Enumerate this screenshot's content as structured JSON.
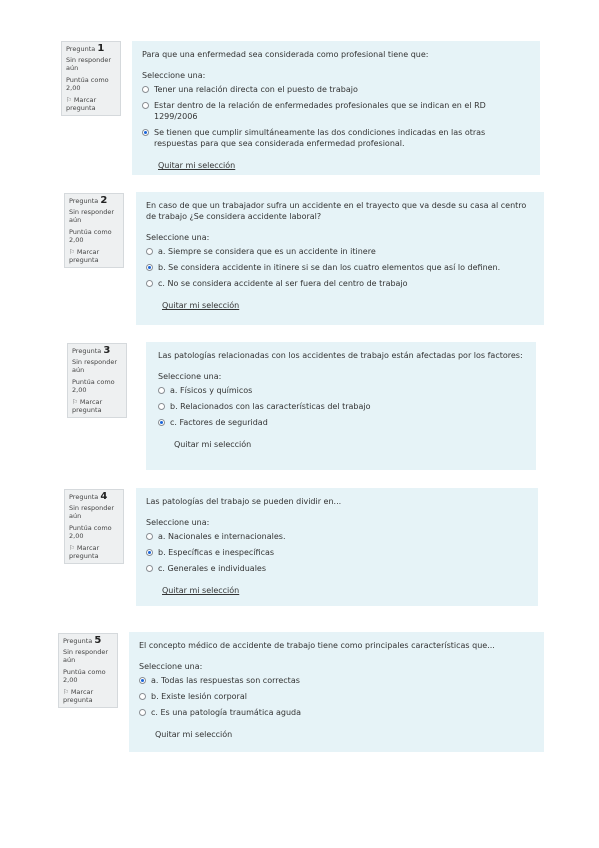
{
  "questions": [
    {
      "label": "Pregunta",
      "number": "1",
      "status": "Sin responder aún",
      "score": "Puntúa como 2,00",
      "flag_label": "Marcar pregunta",
      "text": "Para que una enfermedad sea considerada como profesional tiene que:",
      "select_label": "Seleccione una:",
      "options": [
        {
          "label": "Tener una relación directa con el puesto de trabajo",
          "selected": false
        },
        {
          "label": "Estar dentro de la relación de enfermedades profesionales que se indican en el RD 1299/2006",
          "selected": false
        },
        {
          "label": "Se tienen que cumplir simultáneamente las dos condiciones indicadas en las otras respuestas para que sea considerada enfermedad profesional.",
          "selected": true
        }
      ],
      "clear_label": "Quitar mi selección"
    },
    {
      "label": "Pregunta",
      "number": "2",
      "status": "Sin responder aún",
      "score": "Puntúa como 2,00",
      "flag_label": "Marcar pregunta",
      "text": "En caso de que un trabajador sufra un accidente en el trayecto que va desde su casa al centro de trabajo ¿Se considera accidente laboral?",
      "select_label": "Seleccione una:",
      "options": [
        {
          "label": "a. Siempre se considera que es un accidente in itinere",
          "selected": false
        },
        {
          "label": "b. Se considera accidente in itinere si se dan los cuatro elementos que así lo definen.",
          "selected": true
        },
        {
          "label": "c. No se considera accidente al ser fuera del centro de trabajo",
          "selected": false
        }
      ],
      "clear_label": "Quitar mi selección"
    },
    {
      "label": "Pregunta",
      "number": "3",
      "status": "Sin responder aún",
      "score": "Puntúa como 2,00",
      "flag_label": "Marcar pregunta",
      "text": "Las patologías relacionadas con los accidentes de trabajo están afectadas por los factores:",
      "select_label": "Seleccione una:",
      "options": [
        {
          "label": "a. Físicos y químicos",
          "selected": false
        },
        {
          "label": "b. Relacionados con las características del trabajo",
          "selected": false
        },
        {
          "label": "c. Factores de seguridad",
          "selected": true
        }
      ],
      "clear_label": "Quitar mi selección"
    },
    {
      "label": "Pregunta",
      "number": "4",
      "status": "Sin responder aún",
      "score": "Puntúa como 2,00",
      "flag_label": "Marcar pregunta",
      "text": "Las patologías del trabajo se pueden dividir en...",
      "select_label": "Seleccione una:",
      "options": [
        {
          "label": "a. Nacionales e internacionales.",
          "selected": false
        },
        {
          "label": "b. Específicas e inespecíficas",
          "selected": true
        },
        {
          "label": "c. Generales e individuales",
          "selected": false
        }
      ],
      "clear_label": "Quitar mi selección"
    },
    {
      "label": "Pregunta",
      "number": "5",
      "status": "Sin responder aún",
      "score": "Puntúa como 2,00",
      "flag_label": "Marcar pregunta",
      "text": "El concepto médico de accidente de trabajo tiene como principales características que...",
      "select_label": "Seleccione una:",
      "options": [
        {
          "label": "a. Todas las respuestas son correctas",
          "selected": true
        },
        {
          "label": "b. Existe lesión corporal",
          "selected": false
        },
        {
          "label": "c. Es una patología traumática aguda",
          "selected": false
        }
      ],
      "clear_label": "Quitar mi selección"
    }
  ],
  "colors": {
    "panel_bg": "#e6f3f7",
    "info_bg": "#eef0f1",
    "radio_selected": "#1a66d9"
  },
  "icons": {
    "flag": "flag-icon"
  }
}
